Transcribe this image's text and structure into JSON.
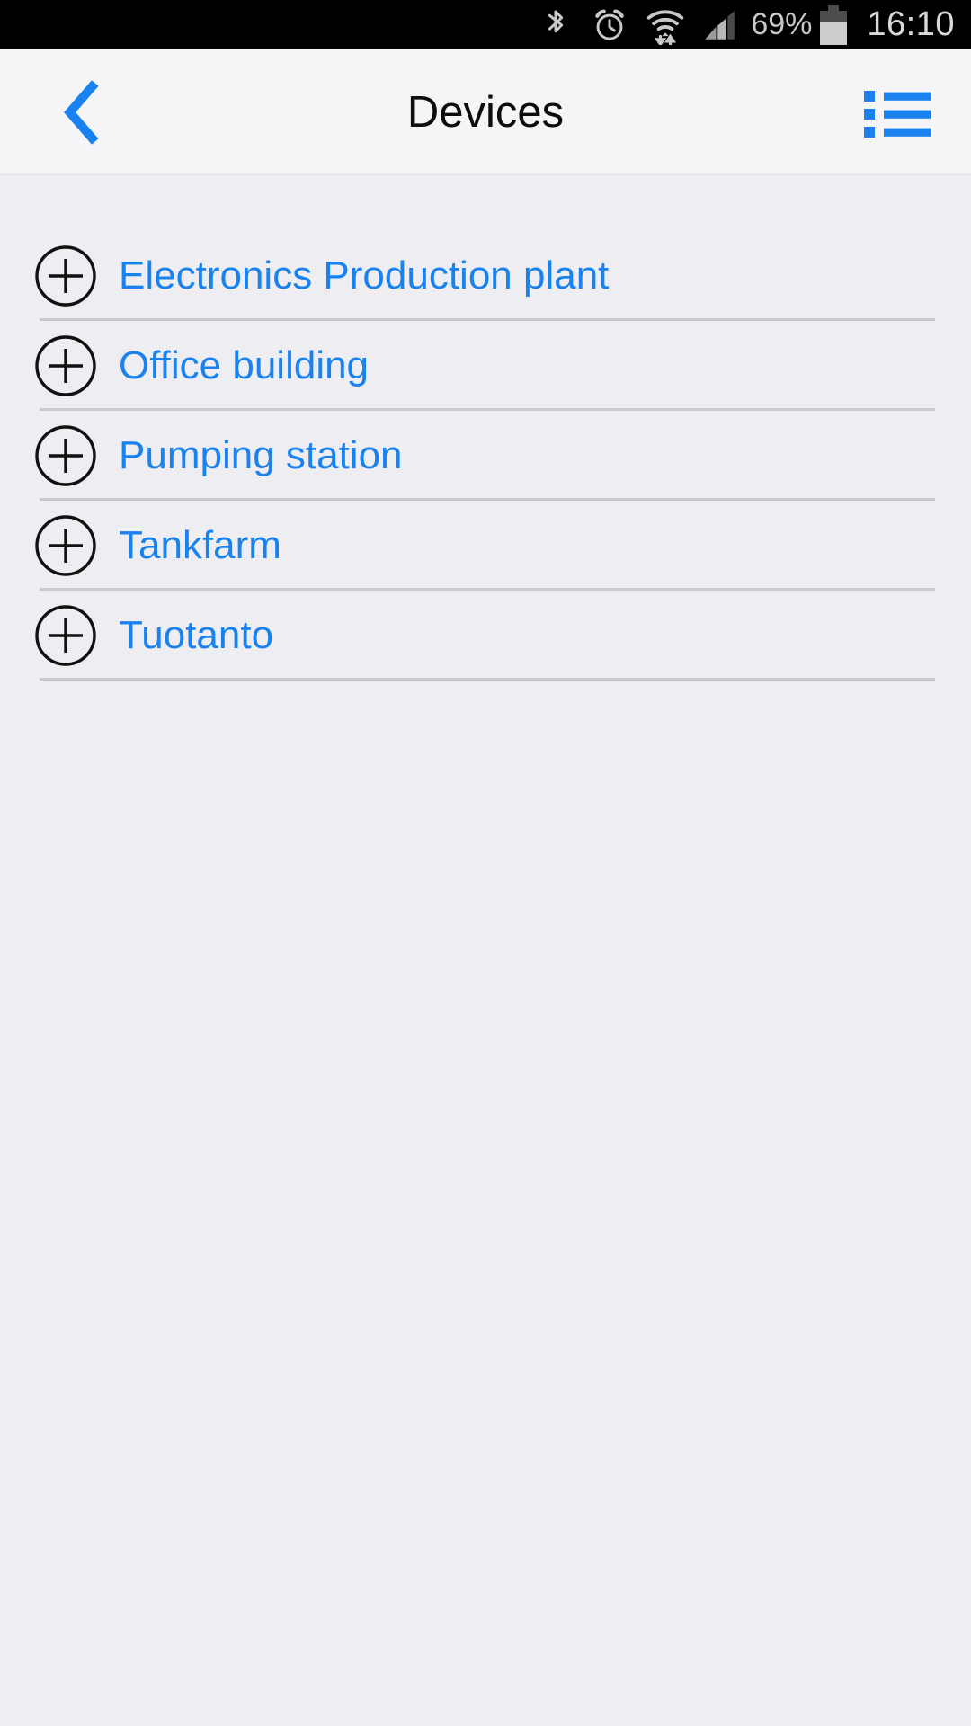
{
  "status_bar": {
    "bluetooth_icon": "bluetooth-icon",
    "alarm_icon": "alarm-clock-icon",
    "wifi_icon": "wifi-data-transfer-icon",
    "signal_icon": "cellular-signal-icon",
    "battery_percent": "69%",
    "battery_icon": "battery-icon",
    "time": "16:10"
  },
  "header": {
    "back_icon": "chevron-left-icon",
    "title": "Devices",
    "menu_icon": "list-menu-icon"
  },
  "list": {
    "add_icon": "plus-circle-icon",
    "items": [
      {
        "label": "Electronics Production plant"
      },
      {
        "label": "Office building"
      },
      {
        "label": "Pumping station"
      },
      {
        "label": "Tankfarm"
      },
      {
        "label": "Tuotanto"
      }
    ]
  },
  "colors": {
    "accent_blue": "#1a82ef",
    "page_background": "#eeeef2",
    "header_background": "#f5f5f7",
    "status_bar_background": "#000000",
    "divider": "#c9c9d0",
    "title_text": "#0d0d0d"
  }
}
